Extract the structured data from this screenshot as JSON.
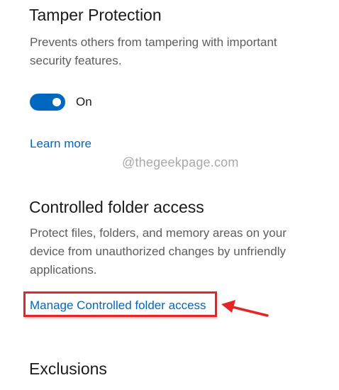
{
  "tamper": {
    "title": "Tamper Protection",
    "description_lines": [
      "Prevents others from tampering with important",
      "security features."
    ],
    "toggle_state_label": "On",
    "learn_more": "Learn more"
  },
  "watermark": "@thegeekpage.com",
  "controlled": {
    "title": "Controlled folder access",
    "description_lines": [
      "Protect files, folders, and memory areas on your",
      "device from unauthorized changes by unfriendly",
      "applications."
    ],
    "manage_link": "Manage Controlled folder access"
  },
  "exclusions": {
    "title": "Exclusions"
  },
  "colors": {
    "accent": "#0067c0",
    "annotation_red": "#e3262a"
  }
}
